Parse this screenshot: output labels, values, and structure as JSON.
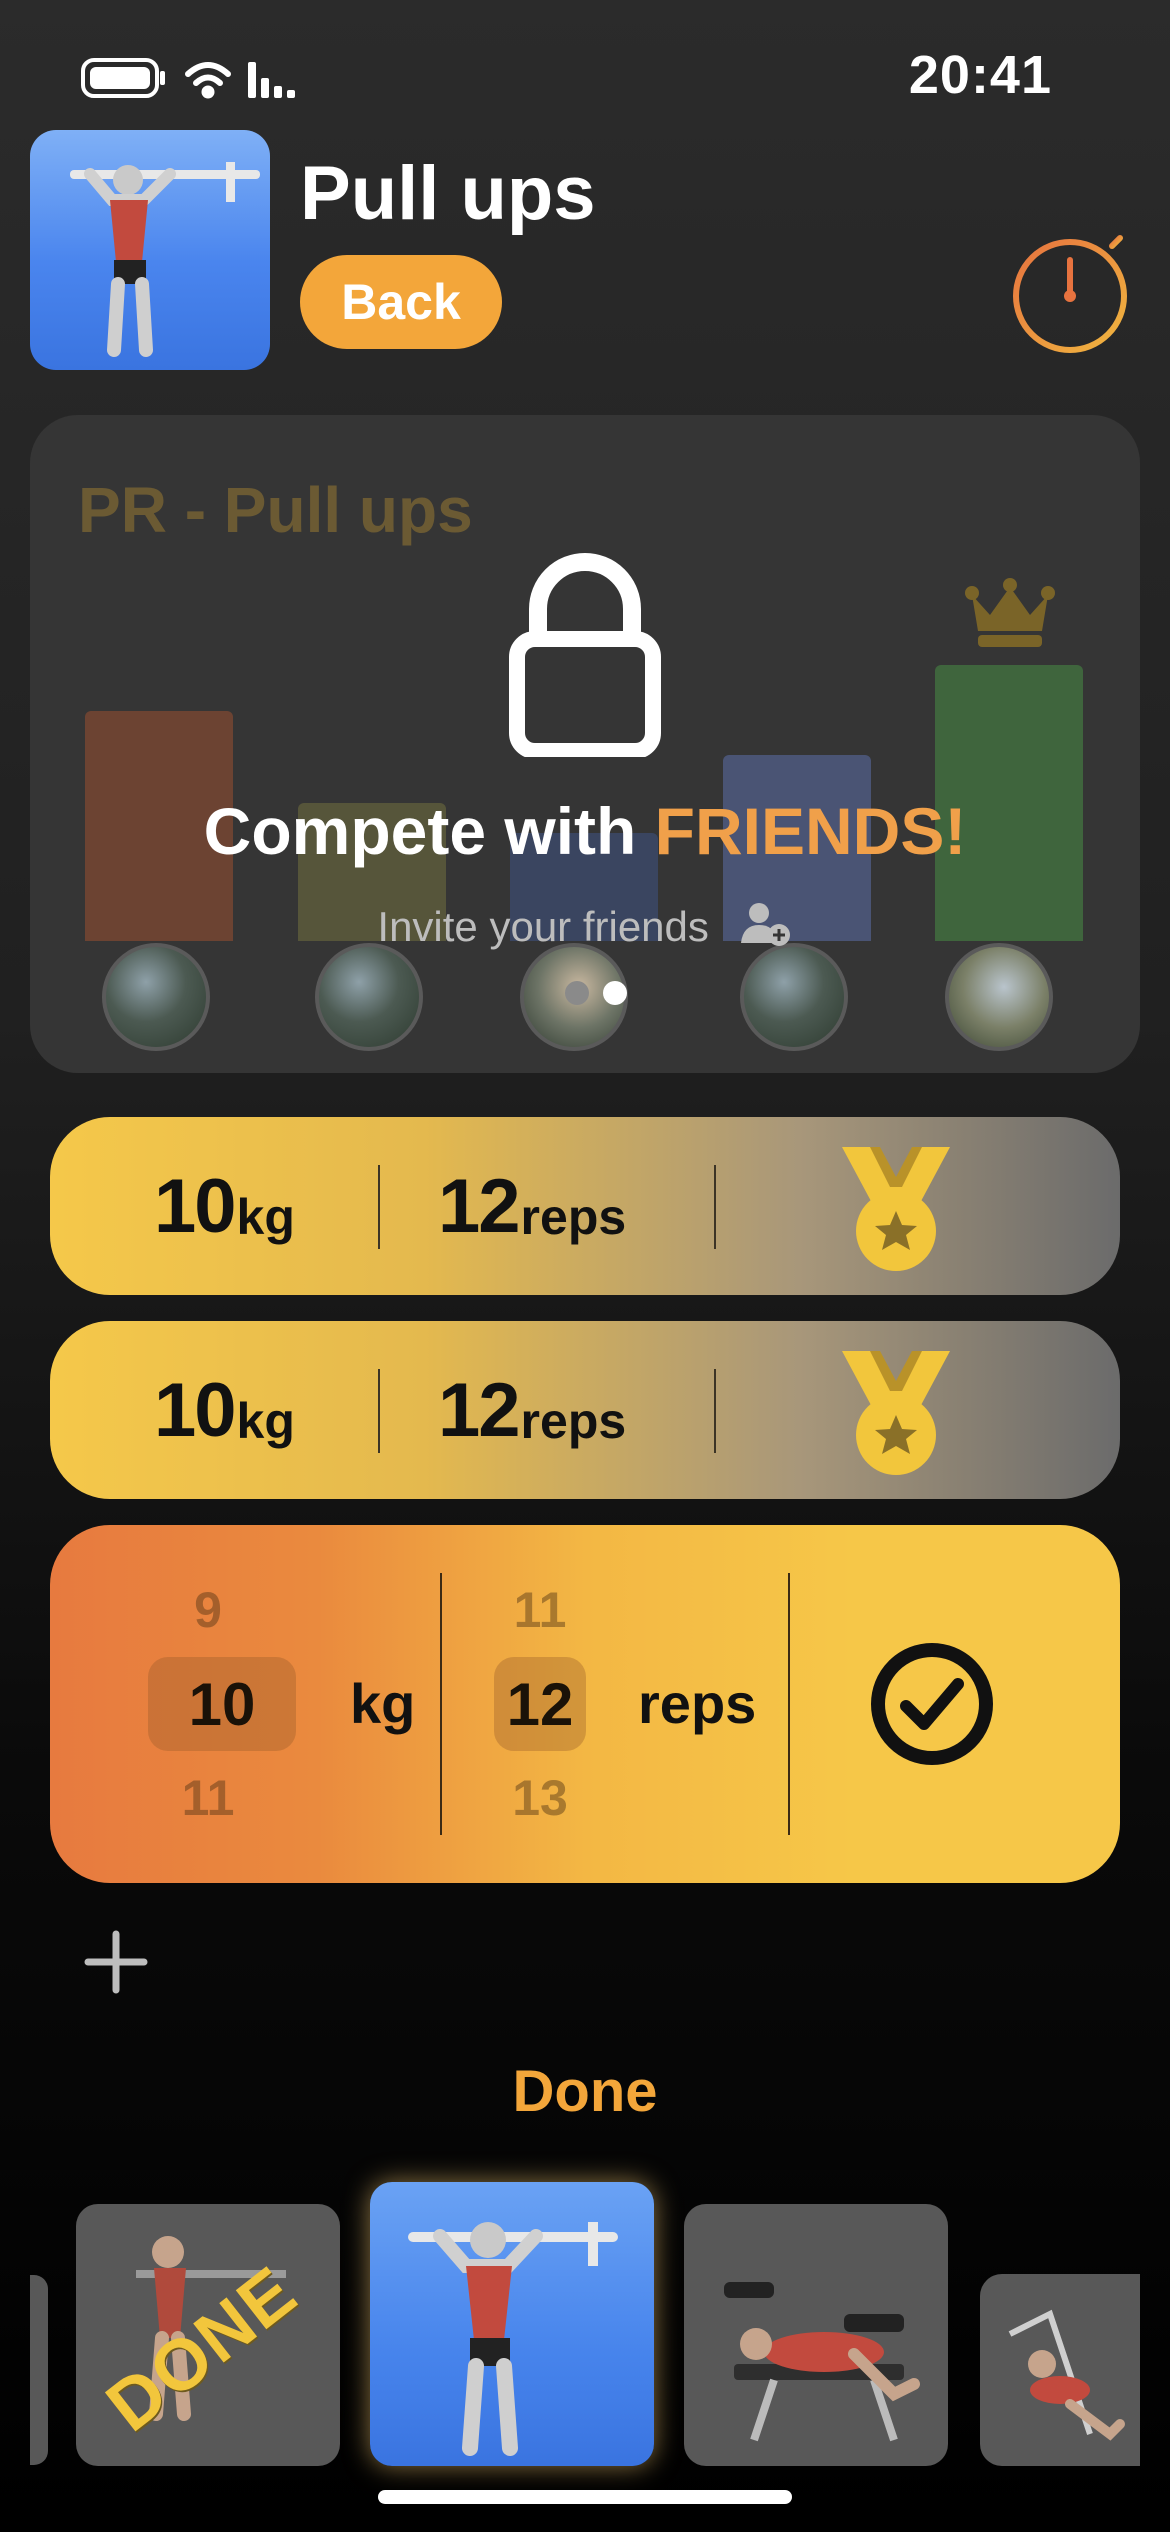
{
  "status_bar": {
    "time": "20:41",
    "icons": [
      "battery-icon",
      "wifi-icon",
      "cellular-signal-icon"
    ]
  },
  "header": {
    "title": "Pull ups",
    "back_label": "Back",
    "timer_icon": "stopwatch-icon"
  },
  "pr_card": {
    "title": "PR - Pull ups",
    "compete_prefix": "Compete with ",
    "compete_highlight": "FRIENDS!",
    "invite_text": "Invite your friends",
    "page_count": 2,
    "active_page": 2,
    "bar_colors": [
      "#7a4a35",
      "#5e5a3a",
      "#3d4a6a",
      "#4c5878",
      "#3f6e3f"
    ],
    "winner_icon": "crown-icon"
  },
  "sets": [
    {
      "weight": "10",
      "weight_unit": "kg",
      "reps": "12",
      "reps_unit": "reps",
      "badge": "medal-icon"
    },
    {
      "weight": "10",
      "weight_unit": "kg",
      "reps": "12",
      "reps_unit": "reps",
      "badge": "medal-icon"
    }
  ],
  "active_set": {
    "weight_above": "9",
    "weight": "10",
    "weight_below": "11",
    "weight_unit": "kg",
    "reps_above": "11",
    "reps": "12",
    "reps_below": "13",
    "reps_unit": "reps",
    "confirm_icon": "checkmark-circle-icon"
  },
  "add_set_icon": "plus-icon",
  "done_label": "Done",
  "carousel": {
    "done_stamp": "DONE"
  },
  "colors": {
    "accent_orange": "#f3a63a",
    "gold": "#f5c84a",
    "friends": "#f0a04a"
  }
}
